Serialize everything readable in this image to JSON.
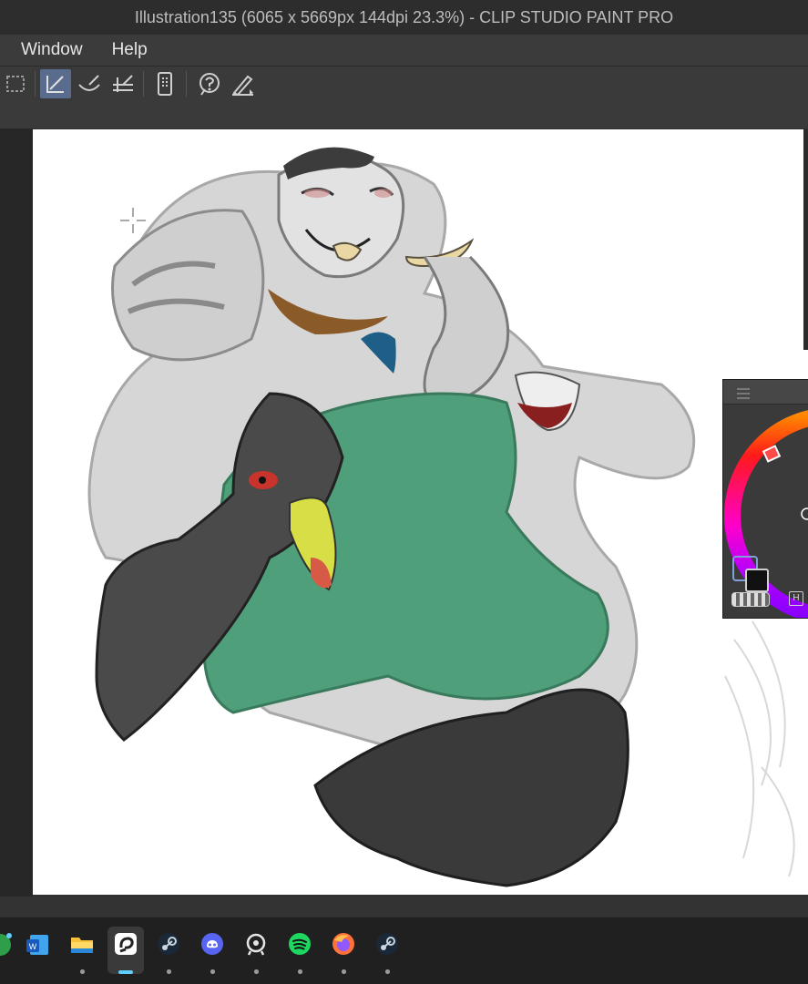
{
  "window": {
    "title": "Illustration135 (6065 x 5669px 144dpi 23.3%)  - CLIP STUDIO PAINT PRO"
  },
  "menu": {
    "items": [
      {
        "label": "Window"
      },
      {
        "label": "Help"
      }
    ]
  },
  "toolbar": {
    "tools": [
      {
        "icon": "selection-icon",
        "active": false
      },
      {
        "icon": "draft-layer-icon",
        "active": true
      },
      {
        "icon": "brush-stroke-icon",
        "active": false
      },
      {
        "icon": "ruler-icon",
        "active": false
      },
      {
        "icon": "device-icon",
        "active": false
      },
      {
        "icon": "help-icon",
        "active": false
      },
      {
        "icon": "pen-settings-icon",
        "active": false
      }
    ]
  },
  "color_palette": {
    "header_icon": "menu-icon",
    "wheel_colors": [
      "#ff0000",
      "#ffff00",
      "#ff00ff",
      "#9b00ff"
    ],
    "main_color": "#111111",
    "sub_color": "#3a3a3a",
    "hsv_label": "H"
  },
  "taskbar": {
    "apps": [
      {
        "icon": "app-green-icon",
        "running": false
      },
      {
        "icon": "word-icon",
        "running": false
      },
      {
        "icon": "file-explorer-icon",
        "running": true
      },
      {
        "icon": "clip-studio-icon",
        "running": true,
        "active": true
      },
      {
        "icon": "steam-icon",
        "running": true
      },
      {
        "icon": "discord-icon",
        "running": true
      },
      {
        "icon": "chat-app-icon",
        "running": true
      },
      {
        "icon": "spotify-icon",
        "running": true
      },
      {
        "icon": "firefox-icon",
        "running": true
      },
      {
        "icon": "steam-alt-icon",
        "running": true
      }
    ]
  },
  "artwork": {
    "colors": {
      "skin": "#d6d6d6",
      "dress": "#4e9f7a",
      "stockings": "#3a3a3a",
      "bird": "#4a4a4a",
      "beak_yellow": "#d8de45",
      "beak_red": "#d65a45",
      "tusk": "#ead8a4",
      "collar": "#8a5a28",
      "gem": "#1f5e86",
      "wine": "#8a1f1f"
    }
  }
}
